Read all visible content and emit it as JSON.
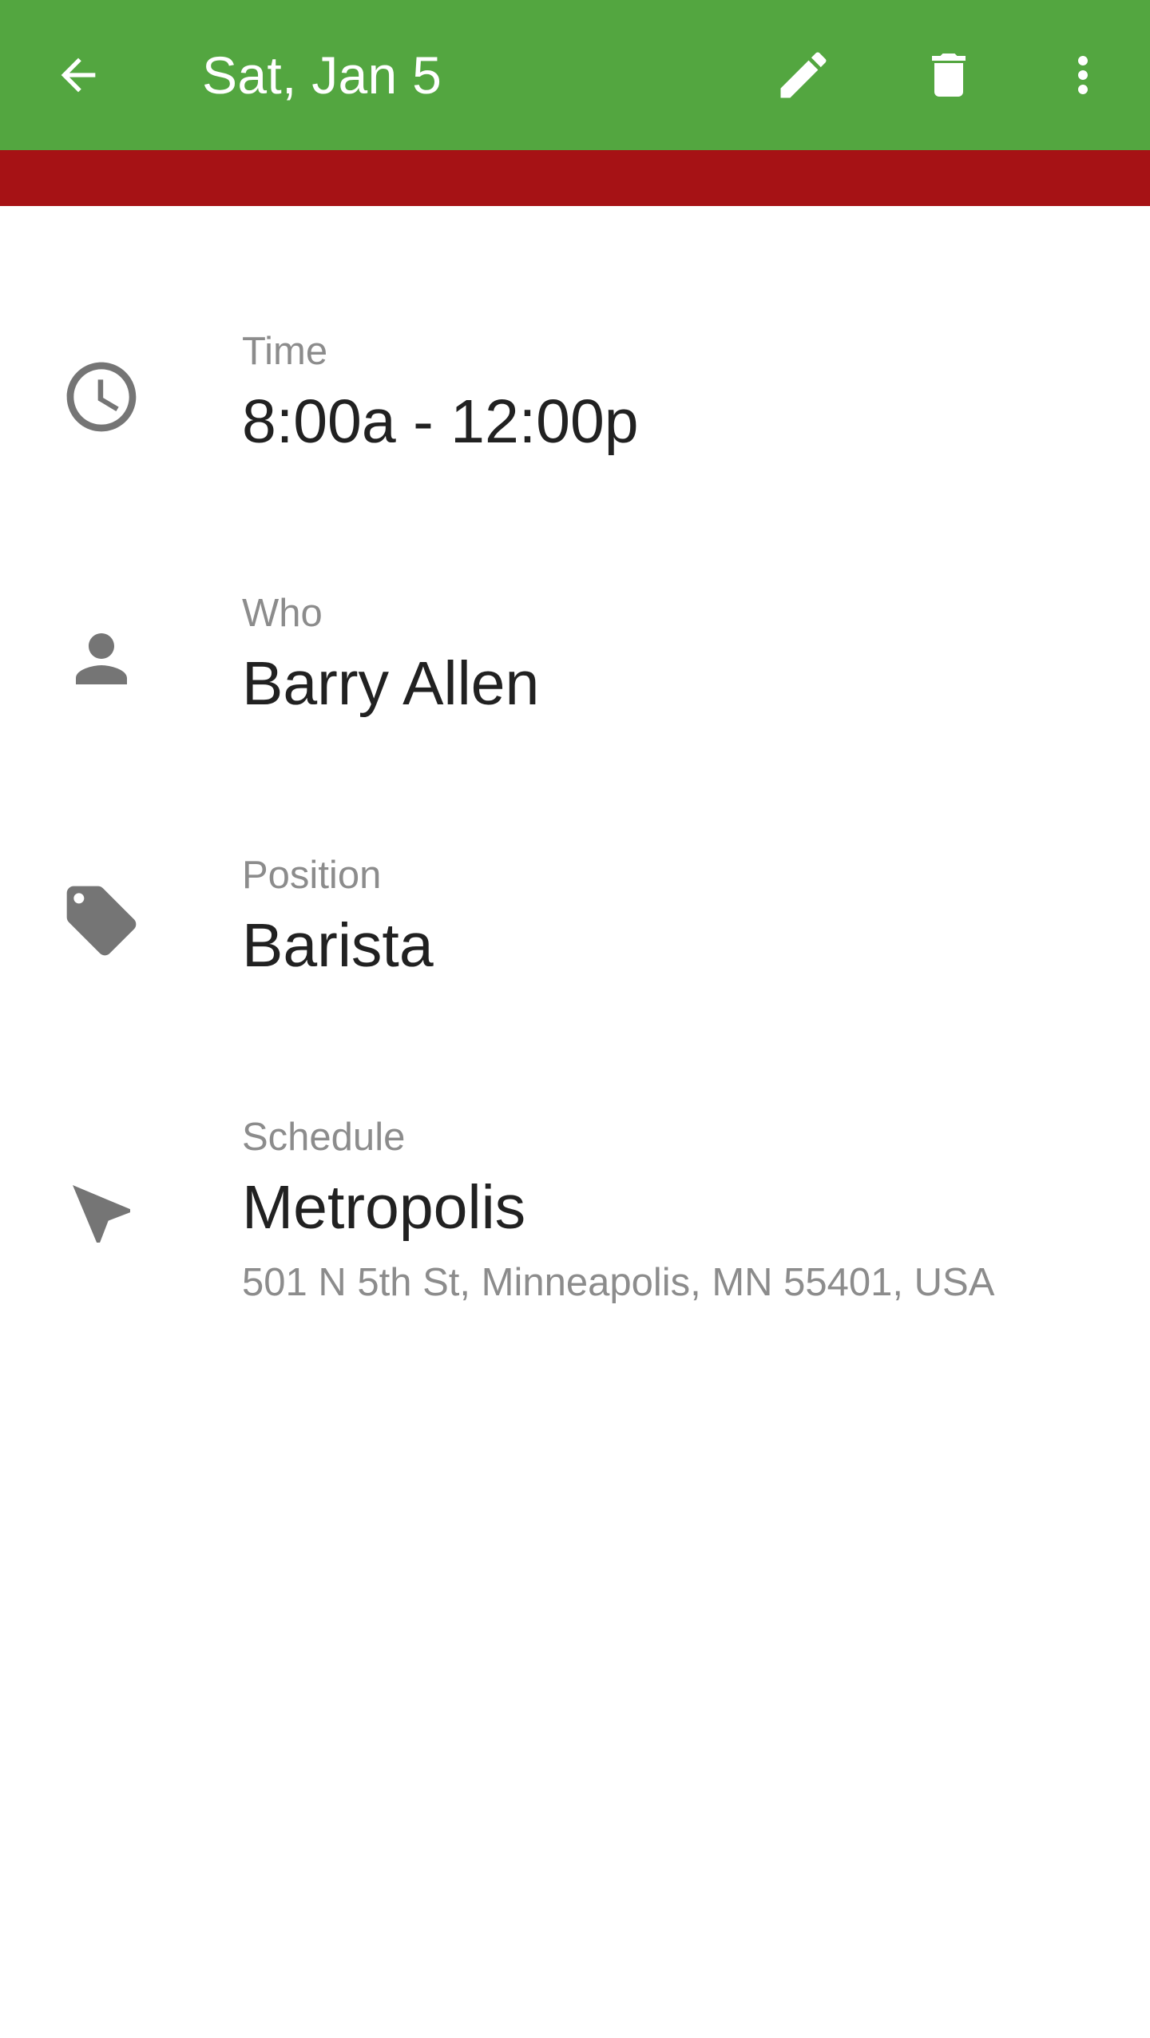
{
  "toolbar": {
    "title": "Sat, Jan 5",
    "icons": {
      "back": "arrow-back-icon",
      "edit": "pencil-icon",
      "delete": "trash-icon",
      "more": "more-vert-icon"
    }
  },
  "colors": {
    "toolbar": "#53a640",
    "accent_bar": "#a61215",
    "label": "#8c8c8c",
    "value": "#212121",
    "icon": "#757575"
  },
  "details": {
    "time": {
      "label": "Time",
      "value": "8:00a - 12:00p",
      "icon": "clock-icon"
    },
    "who": {
      "label": "Who",
      "value": "Barry Allen",
      "icon": "person-icon"
    },
    "position": {
      "label": "Position",
      "value": "Barista",
      "icon": "tag-icon"
    },
    "schedule": {
      "label": "Schedule",
      "value": "Metropolis",
      "address": "501 N 5th St, Minneapolis, MN 55401, USA",
      "icon": "navigation-icon"
    }
  }
}
